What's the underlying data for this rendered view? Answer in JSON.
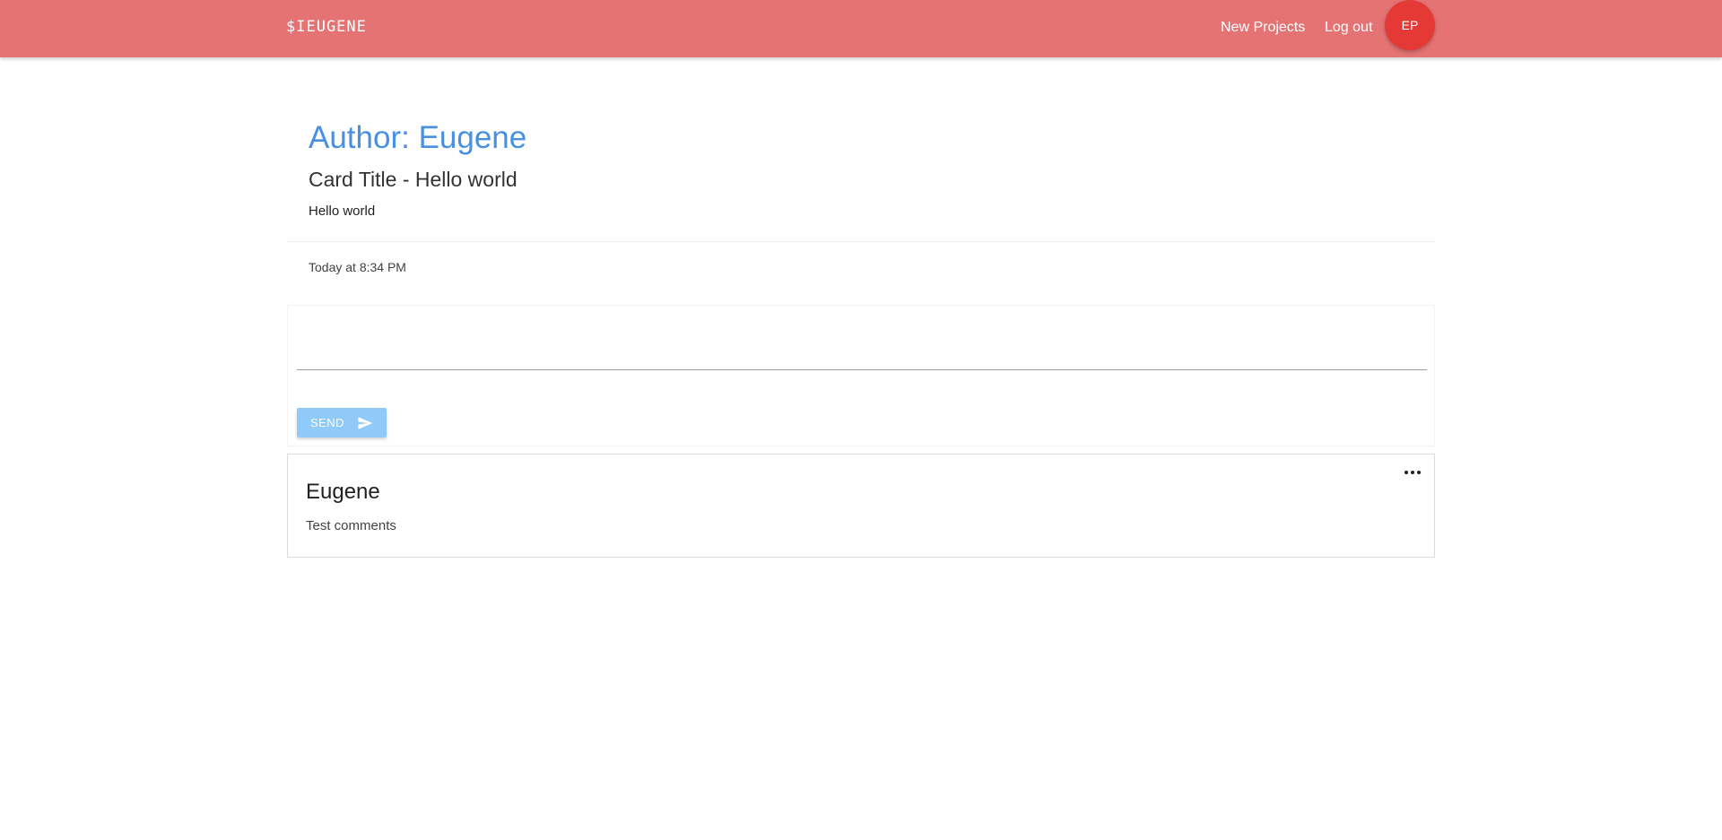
{
  "navbar": {
    "brand": "$IEUGENE",
    "links": [
      "New Projects",
      "Log out"
    ],
    "avatar_initials": "EP",
    "background": "#e57373",
    "avatar_color": "#e53935"
  },
  "post": {
    "author_heading": "Author: Eugene",
    "card_title": "Card Title - Hello world",
    "body": "Hello world",
    "timestamp": "Today at 8:34 PM",
    "accent_color": "#4a90e2"
  },
  "comment_form": {
    "input_value": "",
    "placeholder": "",
    "send_label": "SEND",
    "send_icon": "send-icon",
    "button_color": "#90caf9"
  },
  "comments": [
    {
      "author": "Eugene",
      "text": "Test comments",
      "menu_icon": "more-horizontal-icon"
    }
  ]
}
